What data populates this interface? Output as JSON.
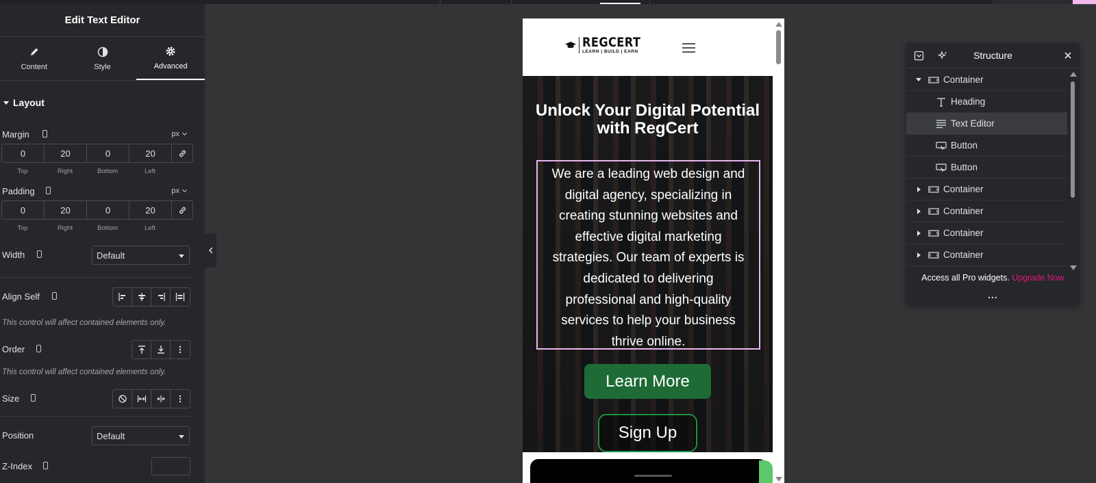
{
  "panel": {
    "title": "Edit Text Editor",
    "tabs": [
      {
        "label": "Content",
        "icon": "pencil-icon"
      },
      {
        "label": "Style",
        "icon": "contrast-icon"
      },
      {
        "label": "Advanced",
        "icon": "gear-icon",
        "active": true
      }
    ],
    "section": "Layout",
    "margin": {
      "label": "Margin",
      "unit": "px",
      "values": [
        "0",
        "20",
        "0",
        "20"
      ],
      "sides": [
        "Top",
        "Right",
        "Bottom",
        "Left"
      ]
    },
    "padding": {
      "label": "Padding",
      "unit": "px",
      "values": [
        "0",
        "20",
        "0",
        "20"
      ],
      "sides": [
        "Top",
        "Right",
        "Bottom",
        "Left"
      ]
    },
    "width": {
      "label": "Width",
      "value": "Default"
    },
    "align_self": {
      "label": "Align Self",
      "hint": "This control will affect contained elements only."
    },
    "order": {
      "label": "Order",
      "hint": "This control will affect contained elements only."
    },
    "size": {
      "label": "Size"
    },
    "position": {
      "label": "Position",
      "value": "Default"
    },
    "zindex": {
      "label": "Z-Index",
      "value": ""
    }
  },
  "preview": {
    "logo_brand": "REGCERT",
    "logo_tag": "LEARN | BUILD | EARN",
    "heading": "Unlock Your Digital Potential with RegCert",
    "text": "We are a leading web design and digital agency, specializing in creating stunning websites and effective digital marketing strategies. Our team of experts is dedicated to delivering professional and high-quality services to help your business thrive online.",
    "button_primary": "Learn More",
    "button_secondary": "Sign Up",
    "colors": {
      "primary_button": "#1e6b35",
      "outline_button": "#1e8f45",
      "selection_border": "#e6b8ee"
    }
  },
  "structure": {
    "title": "Structure",
    "nodes": [
      {
        "label": "Container",
        "icon": "container-icon",
        "level": 0,
        "expanded": true
      },
      {
        "label": "Heading",
        "icon": "heading-icon",
        "level": 1
      },
      {
        "label": "Text Editor",
        "icon": "text-editor-icon",
        "level": 1,
        "selected": true
      },
      {
        "label": "Button",
        "icon": "button-icon",
        "level": 1
      },
      {
        "label": "Button",
        "icon": "button-icon",
        "level": 1
      },
      {
        "label": "Container",
        "icon": "container-icon",
        "level": 0,
        "expanded": false
      },
      {
        "label": "Container",
        "icon": "container-icon",
        "level": 0,
        "expanded": false
      },
      {
        "label": "Container",
        "icon": "container-icon",
        "level": 0,
        "expanded": false
      },
      {
        "label": "Container",
        "icon": "container-icon",
        "level": 0,
        "expanded": false
      }
    ],
    "promo_text": "Access all Pro widgets.",
    "promo_link": "Upgrade Now",
    "more": "...",
    "colors": {
      "promo_link": "#e0197d"
    }
  }
}
